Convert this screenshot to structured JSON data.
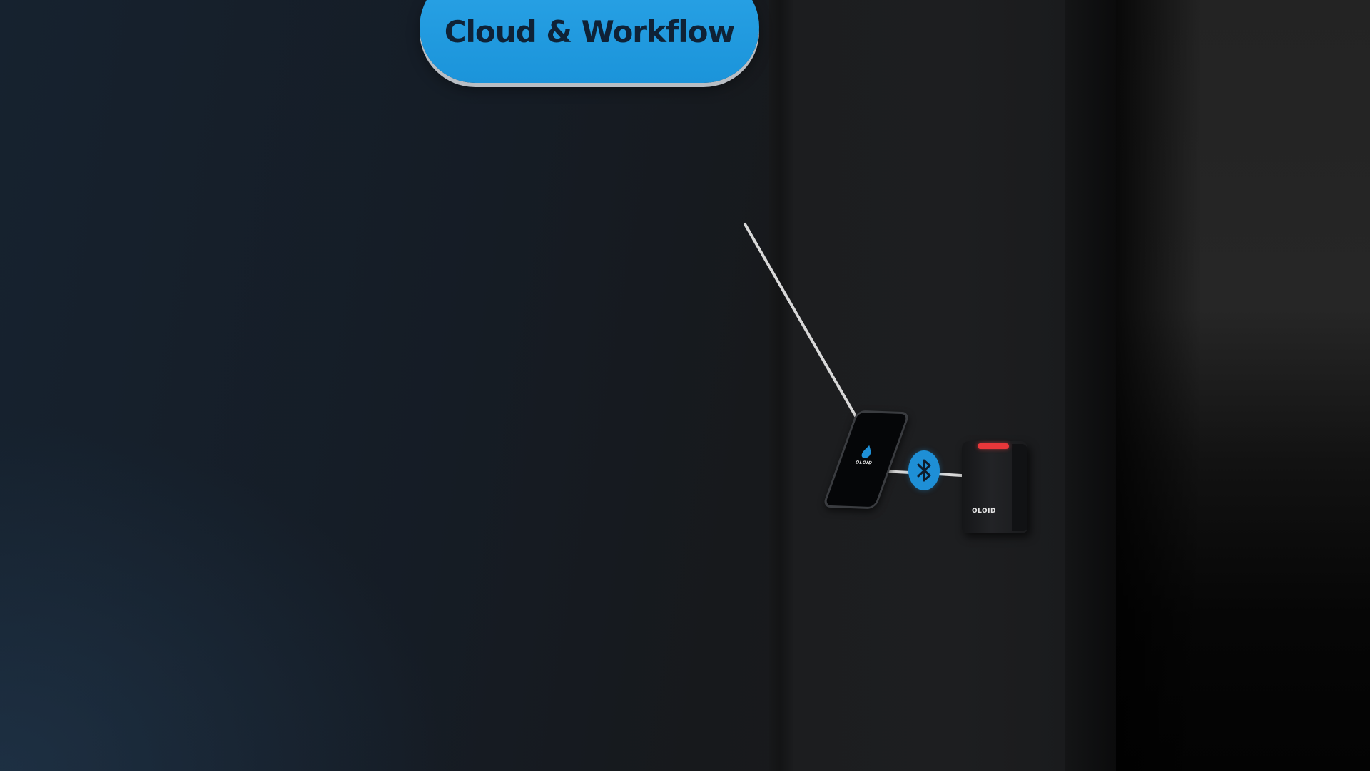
{
  "cloud": {
    "title": "Cloud & Workflow",
    "color": "#1b94da"
  },
  "phone": {
    "brand": "OLOID",
    "icon": "oloid-drop-logo-icon"
  },
  "connection": {
    "icon": "bluetooth-icon",
    "color": "#1e8fd6"
  },
  "reader": {
    "brand": "OLOID",
    "led_color": "#e8373a"
  }
}
